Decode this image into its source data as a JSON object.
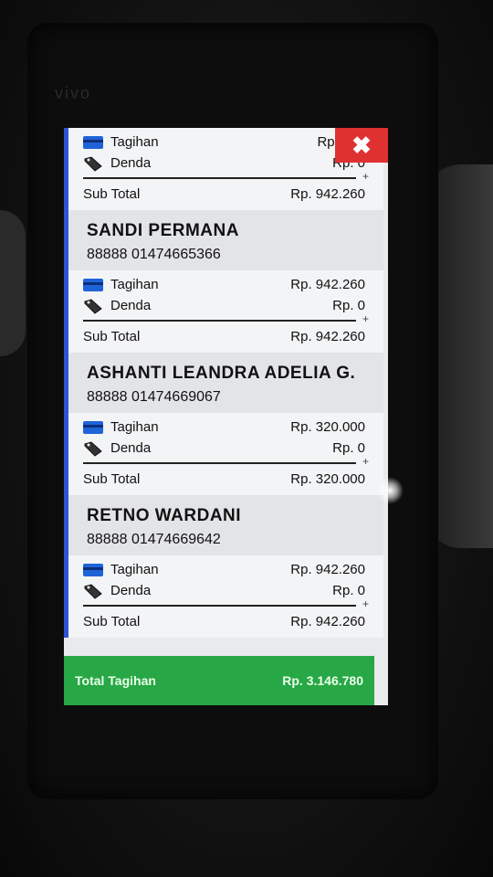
{
  "device": {
    "brand": "vivo"
  },
  "header": {
    "close_icon": "close-x-icon",
    "close_color": "#e03131"
  },
  "top_partial": {
    "tagihan_label": "Tagihan",
    "tagihan_value": "Rp. 942",
    "denda_label": "Denda",
    "denda_value": "Rp. 0",
    "subtotal_label": "Sub Total",
    "subtotal_value": "Rp. 942.260"
  },
  "customers": [
    {
      "name": "SANDI PERMANA",
      "id": "88888 01474665366",
      "tagihan_label": "Tagihan",
      "tagihan_value": "Rp. 942.260",
      "denda_label": "Denda",
      "denda_value": "Rp. 0",
      "subtotal_label": "Sub Total",
      "subtotal_value": "Rp. 942.260"
    },
    {
      "name": "ASHANTI LEANDRA ADELIA G.",
      "id": "88888 01474669067",
      "tagihan_label": "Tagihan",
      "tagihan_value": "Rp. 320.000",
      "denda_label": "Denda",
      "denda_value": "Rp. 0",
      "subtotal_label": "Sub Total",
      "subtotal_value": "Rp. 320.000"
    },
    {
      "name": "RETNO WARDANI",
      "id": "88888 01474669642",
      "tagihan_label": "Tagihan",
      "tagihan_value": "Rp. 942.260",
      "denda_label": "Denda",
      "denda_value": "Rp. 0",
      "subtotal_label": "Sub Total",
      "subtotal_value": "Rp. 942.260"
    }
  ],
  "footer": {
    "total_label": "Total Tagihan",
    "total_value": "Rp. 3.146.780",
    "total_color": "#27a745"
  },
  "colors": {
    "accent_border": "#2f53d6",
    "card_icon": "#1f63d8"
  },
  "icons": {
    "tagihan": "credit-card-icon",
    "denda": "price-tag-icon"
  }
}
